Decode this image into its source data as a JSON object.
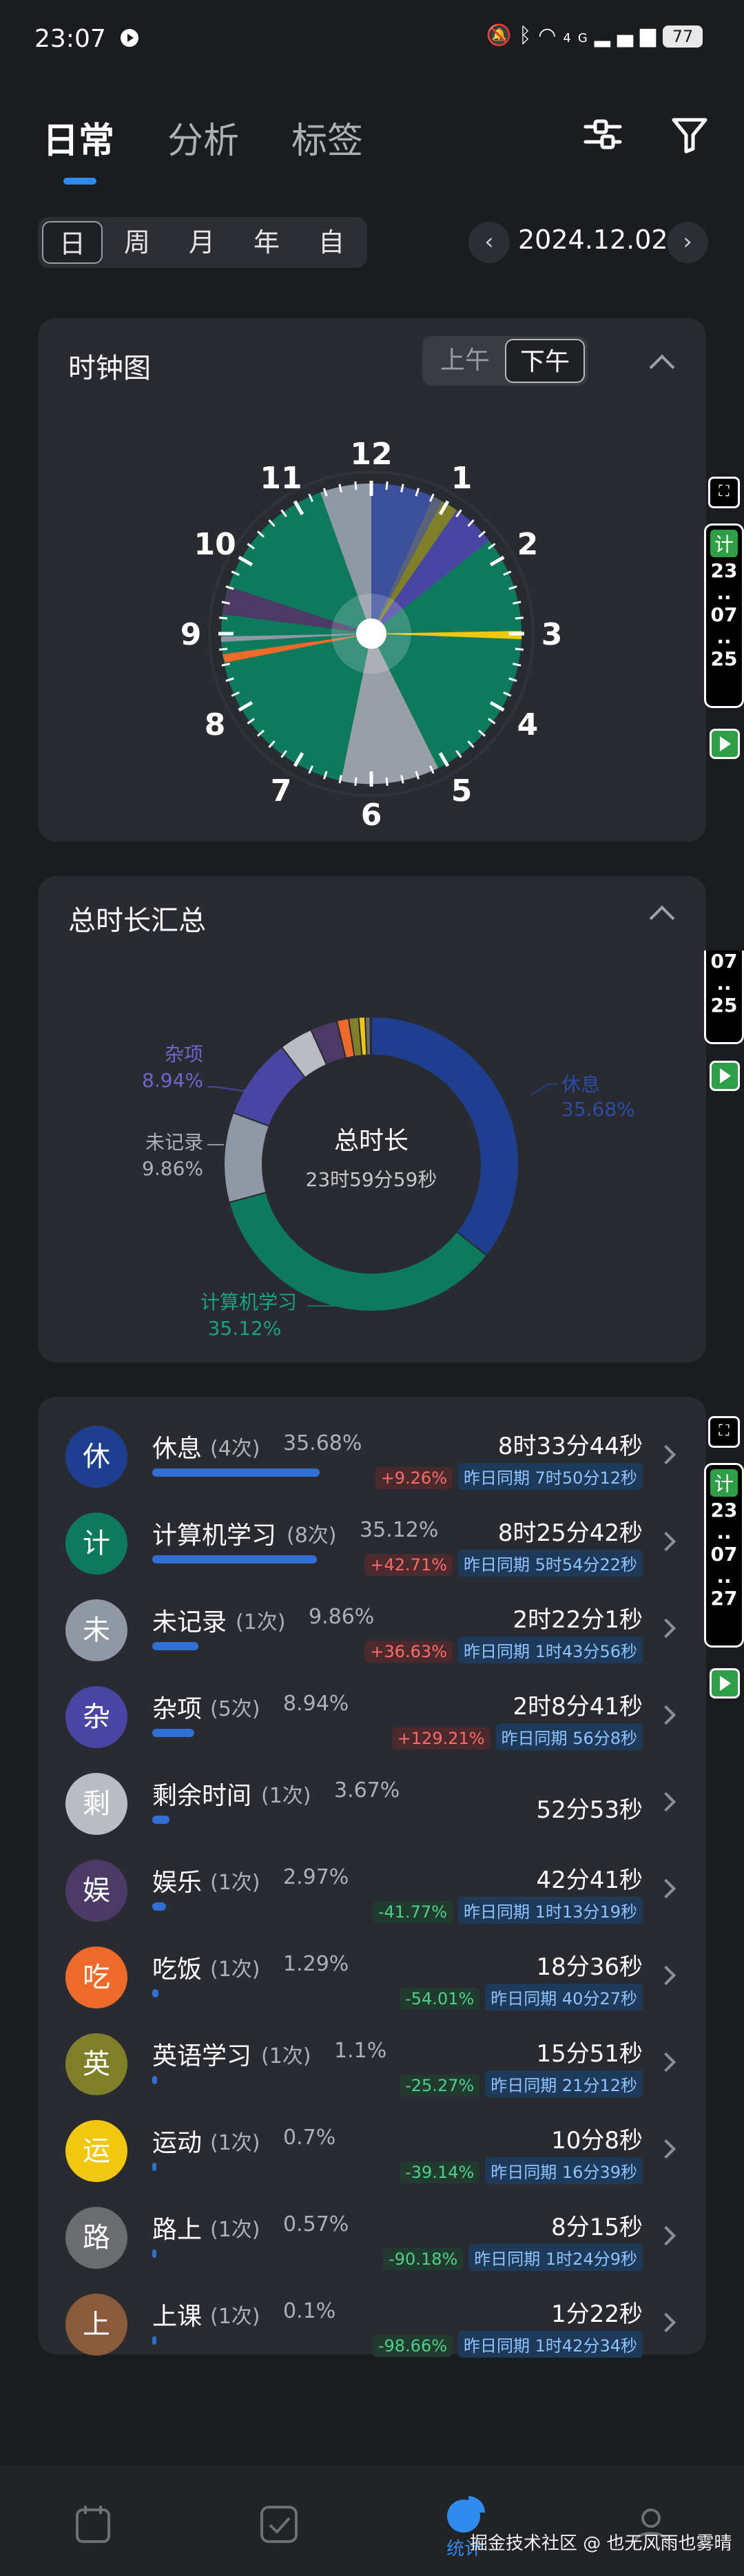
{
  "status_bar": {
    "time": "23:07",
    "signal": "4G",
    "battery": "77"
  },
  "header": {
    "tabs": [
      {
        "label": "日常",
        "active": true
      },
      {
        "label": "分析",
        "active": false
      },
      {
        "label": "标签",
        "active": false
      }
    ],
    "icons": [
      "sliders-icon",
      "filter-icon"
    ]
  },
  "range": {
    "options": [
      {
        "label": "日",
        "active": true
      },
      {
        "label": "周"
      },
      {
        "label": "月"
      },
      {
        "label": "年"
      },
      {
        "label": "自"
      }
    ],
    "date": "2024.12.02"
  },
  "clock_card": {
    "title": "时钟图",
    "am_label": "上午",
    "pm_label": "下午",
    "selected": "下午",
    "hours": [
      "12",
      "1",
      "2",
      "3",
      "4",
      "5",
      "6",
      "7",
      "8",
      "9",
      "10",
      "11"
    ]
  },
  "summary_card": {
    "title": "总时长汇总",
    "center_title": "总时长",
    "center_value": "23时59分59秒"
  },
  "chart_data": {
    "type": "pie",
    "title": "总时长汇总",
    "series": [
      {
        "name": "休息",
        "value": 35.68,
        "color": "#1e3f8f"
      },
      {
        "name": "计算机学习",
        "value": 35.12,
        "color": "#0e7a5c"
      },
      {
        "name": "未记录",
        "value": 9.86,
        "color": "#8f98a4"
      },
      {
        "name": "杂项",
        "value": 8.94,
        "color": "#4a45a3"
      },
      {
        "name": "剩余时间",
        "value": 3.67,
        "color": "#b9bcc2"
      },
      {
        "name": "娱乐",
        "value": 2.97,
        "color": "#4b3a66"
      },
      {
        "name": "吃饭",
        "value": 1.29,
        "color": "#ef6a2a"
      },
      {
        "name": "英语学习",
        "value": 1.1,
        "color": "#7f7f2a"
      },
      {
        "name": "运动",
        "value": 0.7,
        "color": "#f2c80f"
      },
      {
        "name": "路上",
        "value": 0.57,
        "color": "#6b6c70"
      },
      {
        "name": "上课",
        "value": 0.1,
        "color": "#8b5a3b"
      }
    ],
    "labels": [
      {
        "name": "休息",
        "pct": "35.68%"
      },
      {
        "name": "杂项",
        "pct": "8.94%"
      },
      {
        "name": "未记录",
        "pct": "9.86%"
      },
      {
        "name": "计算机学习",
        "pct": "35.12%"
      }
    ]
  },
  "records": [
    {
      "char": "休",
      "name": "休息",
      "count": "(4次)",
      "pct": "35.68%",
      "ratio": 0.3568,
      "color": "#1e3f8f",
      "duration": "8时33分44秒",
      "change": "+9.26%",
      "dir": "up",
      "yesterday": "昨日同期 7时50分12秒"
    },
    {
      "char": "计",
      "name": "计算机学习",
      "count": "(8次)",
      "pct": "35.12%",
      "ratio": 0.3512,
      "color": "#0e7a5c",
      "duration": "8时25分42秒",
      "change": "+42.71%",
      "dir": "up",
      "yesterday": "昨日同期 5时54分22秒"
    },
    {
      "char": "未",
      "name": "未记录",
      "count": "(1次)",
      "pct": "9.86%",
      "ratio": 0.0986,
      "color": "#8f98a4",
      "duration": "2时22分1秒",
      "change": "+36.63%",
      "dir": "up",
      "yesterday": "昨日同期 1时43分56秒"
    },
    {
      "char": "杂",
      "name": "杂项",
      "count": "(5次)",
      "pct": "8.94%",
      "ratio": 0.0894,
      "color": "#4a45a3",
      "duration": "2时8分41秒",
      "change": "+129.21%",
      "dir": "up",
      "yesterday": "昨日同期 56分8秒"
    },
    {
      "char": "剩",
      "name": "剩余时间",
      "count": "(1次)",
      "pct": "3.67%",
      "ratio": 0.0367,
      "color": "#b9bcc2",
      "duration": "52分53秒",
      "change": "",
      "dir": "",
      "yesterday": ""
    },
    {
      "char": "娱",
      "name": "娱乐",
      "count": "(1次)",
      "pct": "2.97%",
      "ratio": 0.0297,
      "color": "#4b3a66",
      "duration": "42分41秒",
      "change": "-41.77%",
      "dir": "down",
      "yesterday": "昨日同期 1时13分19秒"
    },
    {
      "char": "吃",
      "name": "吃饭",
      "count": "(1次)",
      "pct": "1.29%",
      "ratio": 0.0129,
      "color": "#ef6a2a",
      "duration": "18分36秒",
      "change": "-54.01%",
      "dir": "down",
      "yesterday": "昨日同期 40分27秒"
    },
    {
      "char": "英",
      "name": "英语学习",
      "count": "(1次)",
      "pct": "1.1%",
      "ratio": 0.011,
      "color": "#7f7f2a",
      "duration": "15分51秒",
      "change": "-25.27%",
      "dir": "down",
      "yesterday": "昨日同期 21分12秒"
    },
    {
      "char": "运",
      "name": "运动",
      "count": "(1次)",
      "pct": "0.7%",
      "ratio": 0.007,
      "color": "#f2c80f",
      "duration": "10分8秒",
      "change": "-39.14%",
      "dir": "down",
      "yesterday": "昨日同期 16分39秒"
    },
    {
      "char": "路",
      "name": "路上",
      "count": "(1次)",
      "pct": "0.57%",
      "ratio": 0.0057,
      "color": "#6b6c70",
      "duration": "8分15秒",
      "change": "-90.18%",
      "dir": "down",
      "yesterday": "昨日同期 1时24分9秒"
    },
    {
      "char": "上",
      "name": "上课",
      "count": "(1次)",
      "pct": "0.1%",
      "ratio": 0.001,
      "color": "#8b5a3b",
      "duration": "1分22秒",
      "change": "-98.66%",
      "dir": "down",
      "yesterday": "昨日同期 1时42分34秒"
    }
  ],
  "side_widgets": [
    {
      "tag": "计",
      "lines": [
        "23",
        "..",
        "07",
        "..",
        "25"
      ]
    },
    {
      "lines": [
        "07",
        "..",
        "25"
      ]
    },
    {
      "tag": "计",
      "lines": [
        "23",
        "..",
        "07",
        "..",
        "27"
      ]
    }
  ],
  "bottom_nav": {
    "active_label": "统计",
    "items": [
      "calendar-icon",
      "check-icon",
      "stats-icon",
      "profile-icon"
    ]
  },
  "watermark": "掘金技术社区 @ 也无风雨也雾晴"
}
